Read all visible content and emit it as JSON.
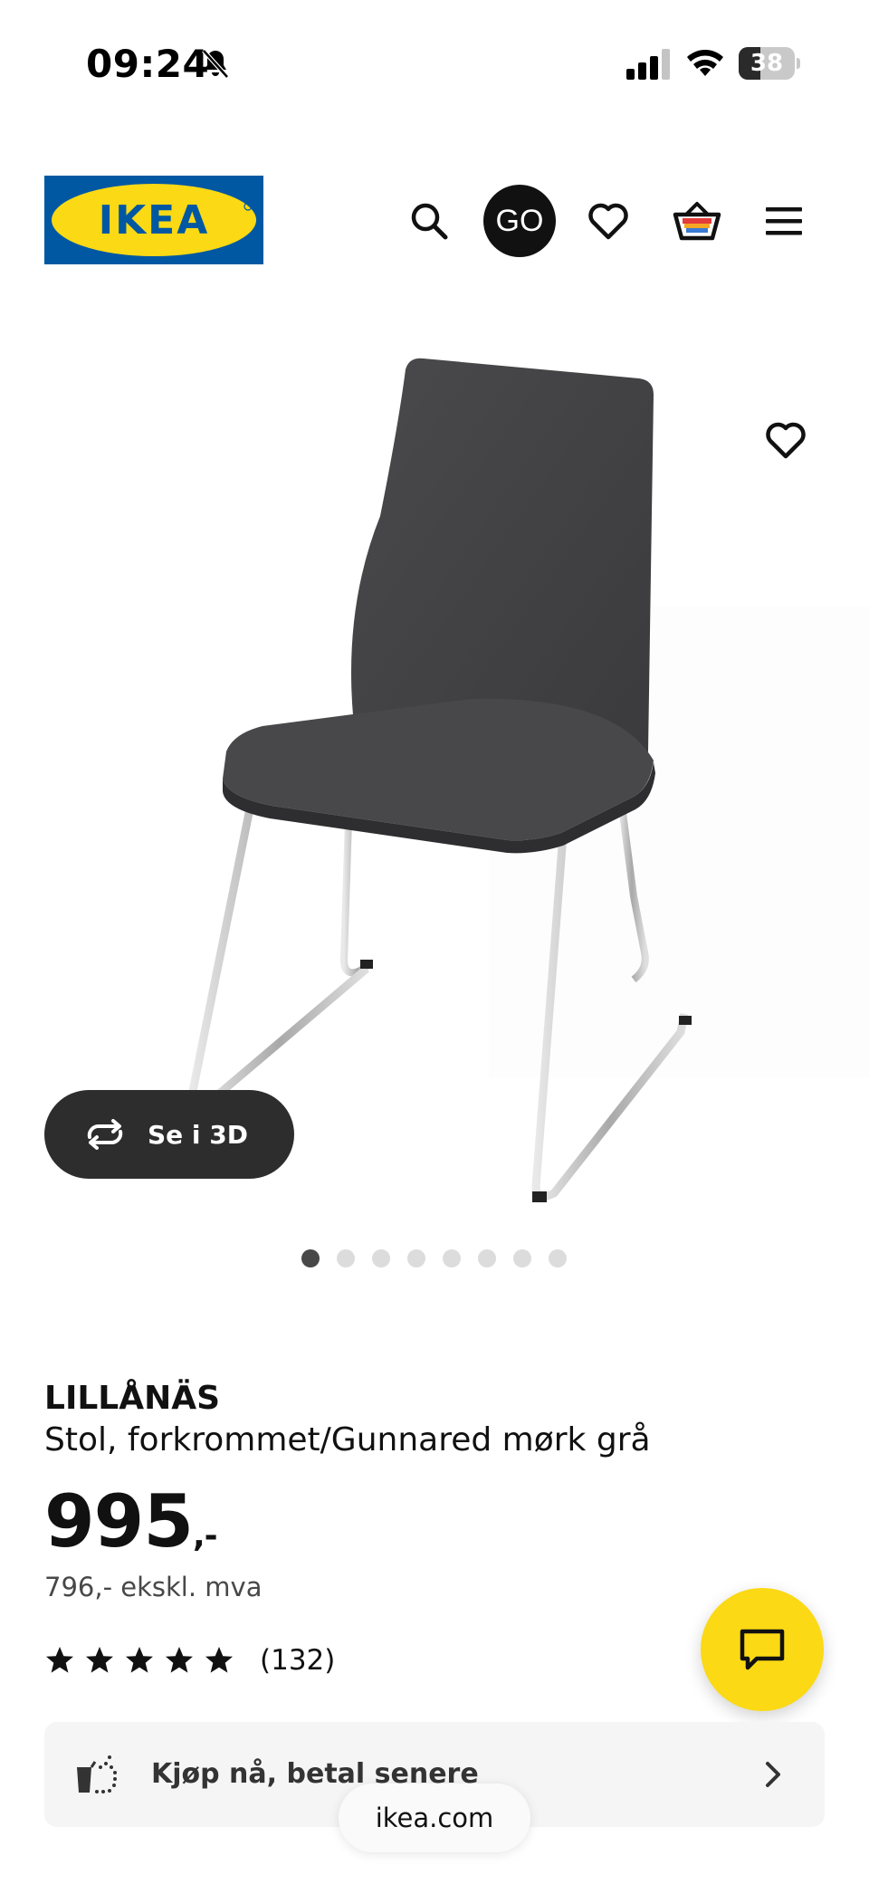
{
  "status_bar": {
    "time": "09:24",
    "battery_level": "38",
    "battery_fraction": 0.38
  },
  "header": {
    "logo_text": "IKEA",
    "go_label": "GO",
    "icons": [
      "search-icon",
      "heart-icon",
      "basket-icon",
      "menu-icon"
    ]
  },
  "gallery": {
    "view_3d_label": "Se i 3D",
    "image_count": 8,
    "active_index": 0
  },
  "product": {
    "name": "LILLÅNÄS",
    "description": "Stol, forkrommet/Gunnared mørk grå",
    "price": "995",
    "price_suffix": ",-",
    "price_ex_vat": "796,- ekskl. mva",
    "rating": 5,
    "review_count": "(132)"
  },
  "financing": {
    "label": "Kjøp nå, betal senere"
  },
  "browser": {
    "url": "ikea.com"
  },
  "colors": {
    "ikea_blue": "#0058a3",
    "ikea_yellow": "#fbd914",
    "text": "#111111"
  }
}
